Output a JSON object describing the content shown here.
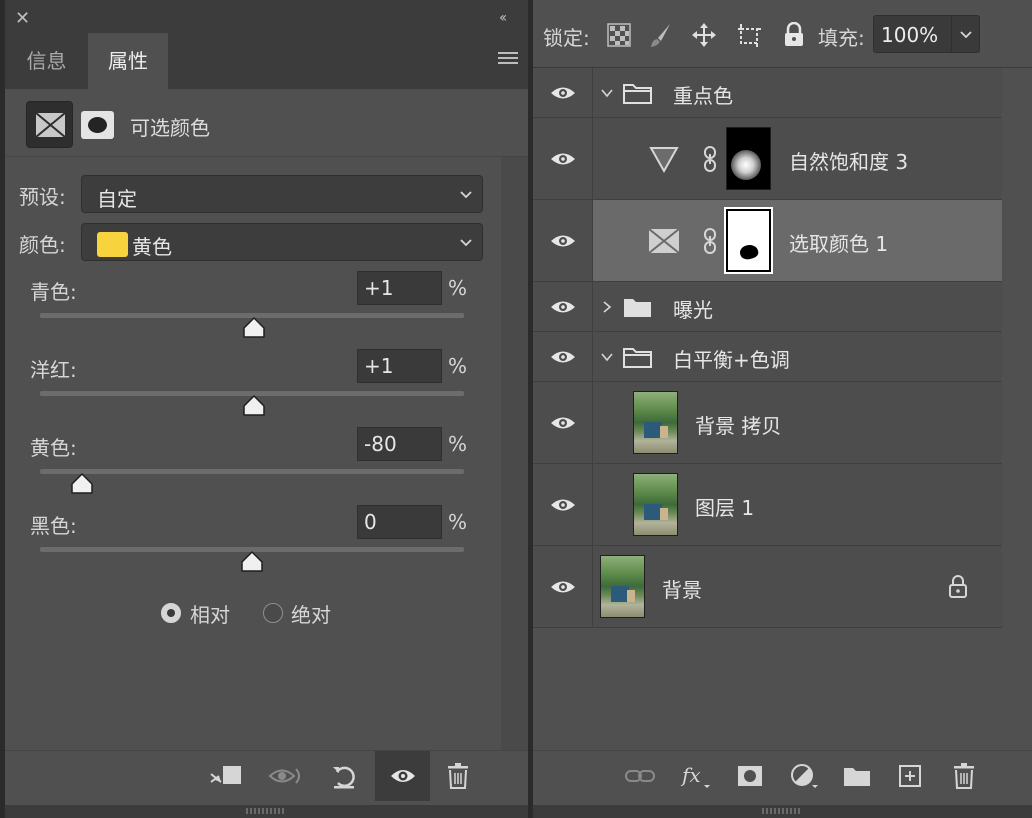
{
  "properties_panel": {
    "tabs": [
      {
        "label": "信息",
        "active": false
      },
      {
        "label": "属性",
        "active": true
      }
    ],
    "adjustment_title": "可选颜色",
    "preset": {
      "label": "预设:",
      "value": "自定"
    },
    "colors": {
      "label": "颜色:",
      "value": "黄色",
      "swatch_color": "#f7d33e"
    },
    "sliders": [
      {
        "label": "青色:",
        "value": "+1",
        "unit": "%",
        "slider_value": 1,
        "min": -100,
        "max": 100
      },
      {
        "label": "洋红:",
        "value": "+1",
        "unit": "%",
        "slider_value": 1,
        "min": -100,
        "max": 100
      },
      {
        "label": "黄色:",
        "value": "-80",
        "unit": "%",
        "slider_value": -80,
        "min": -100,
        "max": 100
      },
      {
        "label": "黑色:",
        "value": "0",
        "unit": "%",
        "slider_value": 0,
        "min": -100,
        "max": 100
      }
    ],
    "method": {
      "options": [
        "相对",
        "绝对"
      ],
      "selected": "相对"
    },
    "footer_icons": [
      "clip-to-layer-icon",
      "view-previous-state-icon",
      "reset-icon",
      "visibility-eye-icon",
      "delete-icon"
    ]
  },
  "layers_panel": {
    "lock_label": "锁定:",
    "fill_label": "填充:",
    "fill_value": "100%",
    "layers": [
      {
        "type": "group",
        "name": "重点色",
        "expanded": true,
        "visible": true
      },
      {
        "type": "adjustment-vibrance",
        "name": "自然饱和度 3",
        "visible": true
      },
      {
        "type": "adjustment-selective-color",
        "name": "选取颜色 1",
        "visible": true,
        "selected": true
      },
      {
        "type": "group",
        "name": "曝光",
        "expanded": false,
        "visible": true
      },
      {
        "type": "group",
        "name": "白平衡+色调",
        "expanded": true,
        "visible": true
      },
      {
        "type": "pixel",
        "name": "背景 拷贝",
        "visible": true
      },
      {
        "type": "pixel",
        "name": "图层 1",
        "visible": true
      },
      {
        "type": "background",
        "name": "背景",
        "visible": true,
        "locked": true
      }
    ],
    "footer_icons": [
      "link-layers-icon",
      "fx-icon",
      "add-mask-icon",
      "adjustment-layer-icon",
      "new-group-icon",
      "new-layer-icon",
      "delete-layer-icon"
    ]
  },
  "colors": {
    "panel_bg": "#505050",
    "header_bg": "#3c3c3c",
    "selected_layer": "#6a6a6a",
    "yellow": "#f7d33e"
  }
}
